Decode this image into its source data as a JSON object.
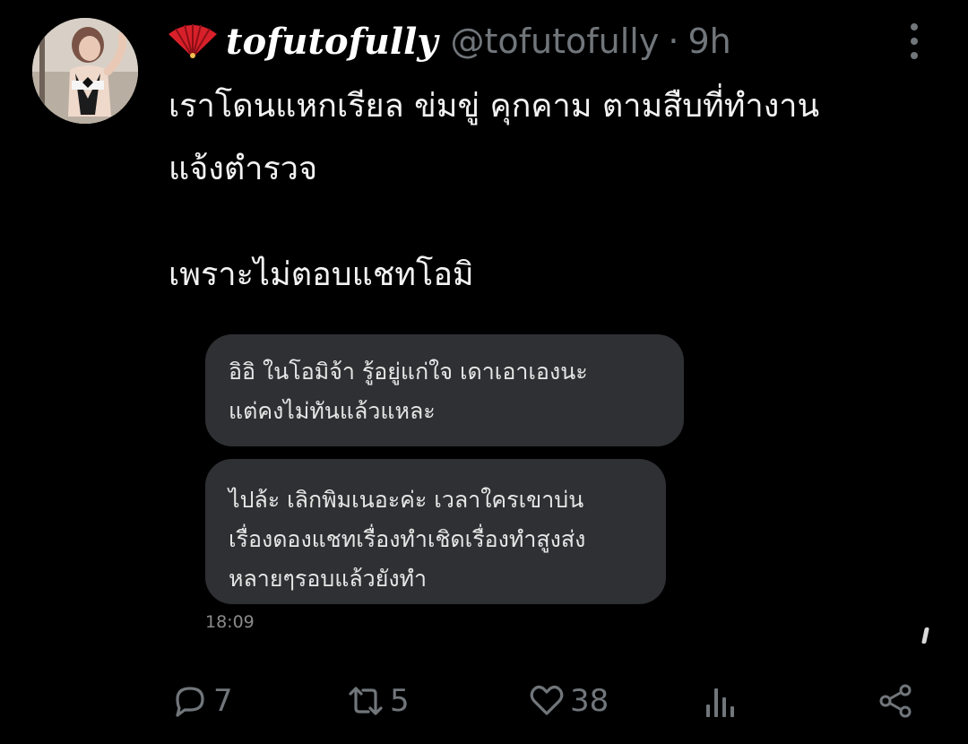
{
  "tweet": {
    "author": {
      "display_name": "tofutofully",
      "handle": "@tofutofully",
      "emoji_icon": "red-fan-icon"
    },
    "time_separator": "·",
    "time_ago": "9h",
    "text_lines": [
      "เราโดนแหกเรียล ข่มขู่ คุกคาม ตามสืบที่ทำงาน",
      "แจ้งตำรวจ"
    ],
    "text_paragraph2": "เพราะไม่ตอบแชทโอมิ",
    "more_icon": "more-vertical-icon"
  },
  "chat_screenshot": {
    "messages": [
      {
        "lines": [
          "อิอิ  ในโอมิจ้า  รู้อยู่แก่ใจ  เดาเอาเองนะ",
          "แต่คงไม่ทันแล้วแหละ"
        ]
      },
      {
        "lines": [
          "ไปล้ะ  เลิกพิมเนอะค่ะ  เวลาใครเขาบ่น",
          "เรื่องดองแชทเรื่องทำเชิดเรื่องทำสูงส่ง",
          "หลายๆรอบแล้วยังทำ"
        ]
      }
    ],
    "timestamp": "18:09",
    "bubble_color": "#2f3033"
  },
  "actions": {
    "reply": {
      "icon": "reply-icon",
      "count": "7"
    },
    "retweet": {
      "icon": "retweet-icon",
      "count": "5"
    },
    "like": {
      "icon": "heart-icon",
      "count": "38"
    },
    "views": {
      "icon": "analytics-icon"
    },
    "share": {
      "icon": "share-icon"
    }
  },
  "colors": {
    "background": "#000000",
    "muted": "#71767b",
    "text": "#e7e9ea"
  }
}
